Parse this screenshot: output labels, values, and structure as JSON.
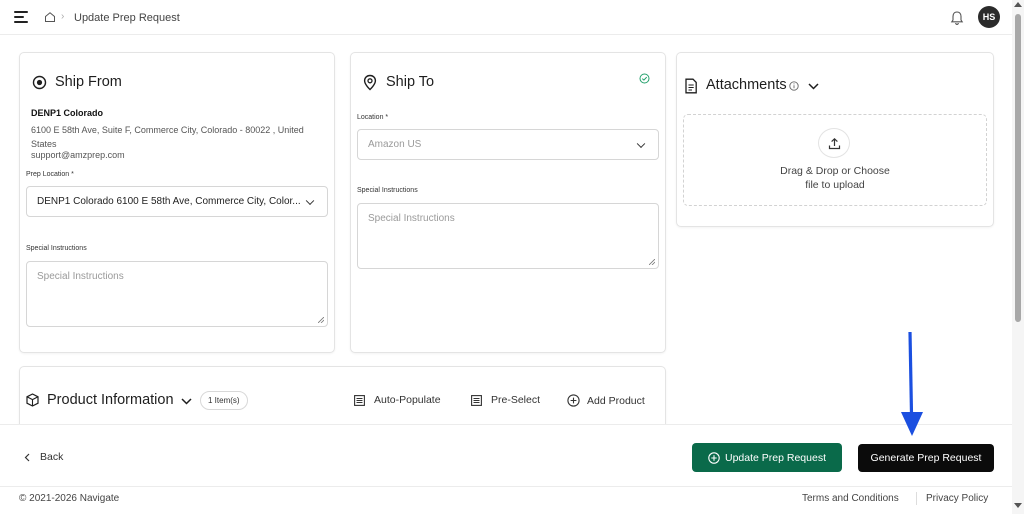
{
  "header": {
    "breadcrumb_title": "Update Prep Request",
    "avatar_initials": "HS"
  },
  "ship_from": {
    "title": "Ship From",
    "name": "DENP1 Colorado",
    "address": "6100 E 58th Ave, Suite F, Commerce City, Colorado - 80022 , United States",
    "email": "support@amzprep.com",
    "prep_location_label": "Prep Location *",
    "prep_location_value": "DENP1 Colorado 6100 E 58th Ave, Commerce City, Color...",
    "special_label": "Special Instructions",
    "special_placeholder": "Special Instructions"
  },
  "ship_to": {
    "title": "Ship To",
    "location_label": "Location *",
    "location_placeholder": "Amazon US",
    "special_label": "Special Instructions",
    "special_placeholder": "Special Instructions"
  },
  "attachments": {
    "title": "Attachments",
    "upload_line1": "Drag & Drop or Choose",
    "upload_line2": "file to upload"
  },
  "product_info": {
    "title": "Product Information",
    "count_badge": "1 Item(s)",
    "auto_populate": "Auto-Populate",
    "pre_select": "Pre-Select",
    "add_product": "Add Product"
  },
  "footer": {
    "back": "Back",
    "update_button": "Update Prep Request",
    "generate_button": "Generate Prep Request",
    "copyright": "© 2021-2026 Navigate",
    "terms": "Terms and Conditions",
    "privacy": "Privacy Policy"
  },
  "colors": {
    "primary_green": "#0a6a4a",
    "annotation_arrow": "#1b4fe0",
    "check_green": "#22a06b"
  }
}
